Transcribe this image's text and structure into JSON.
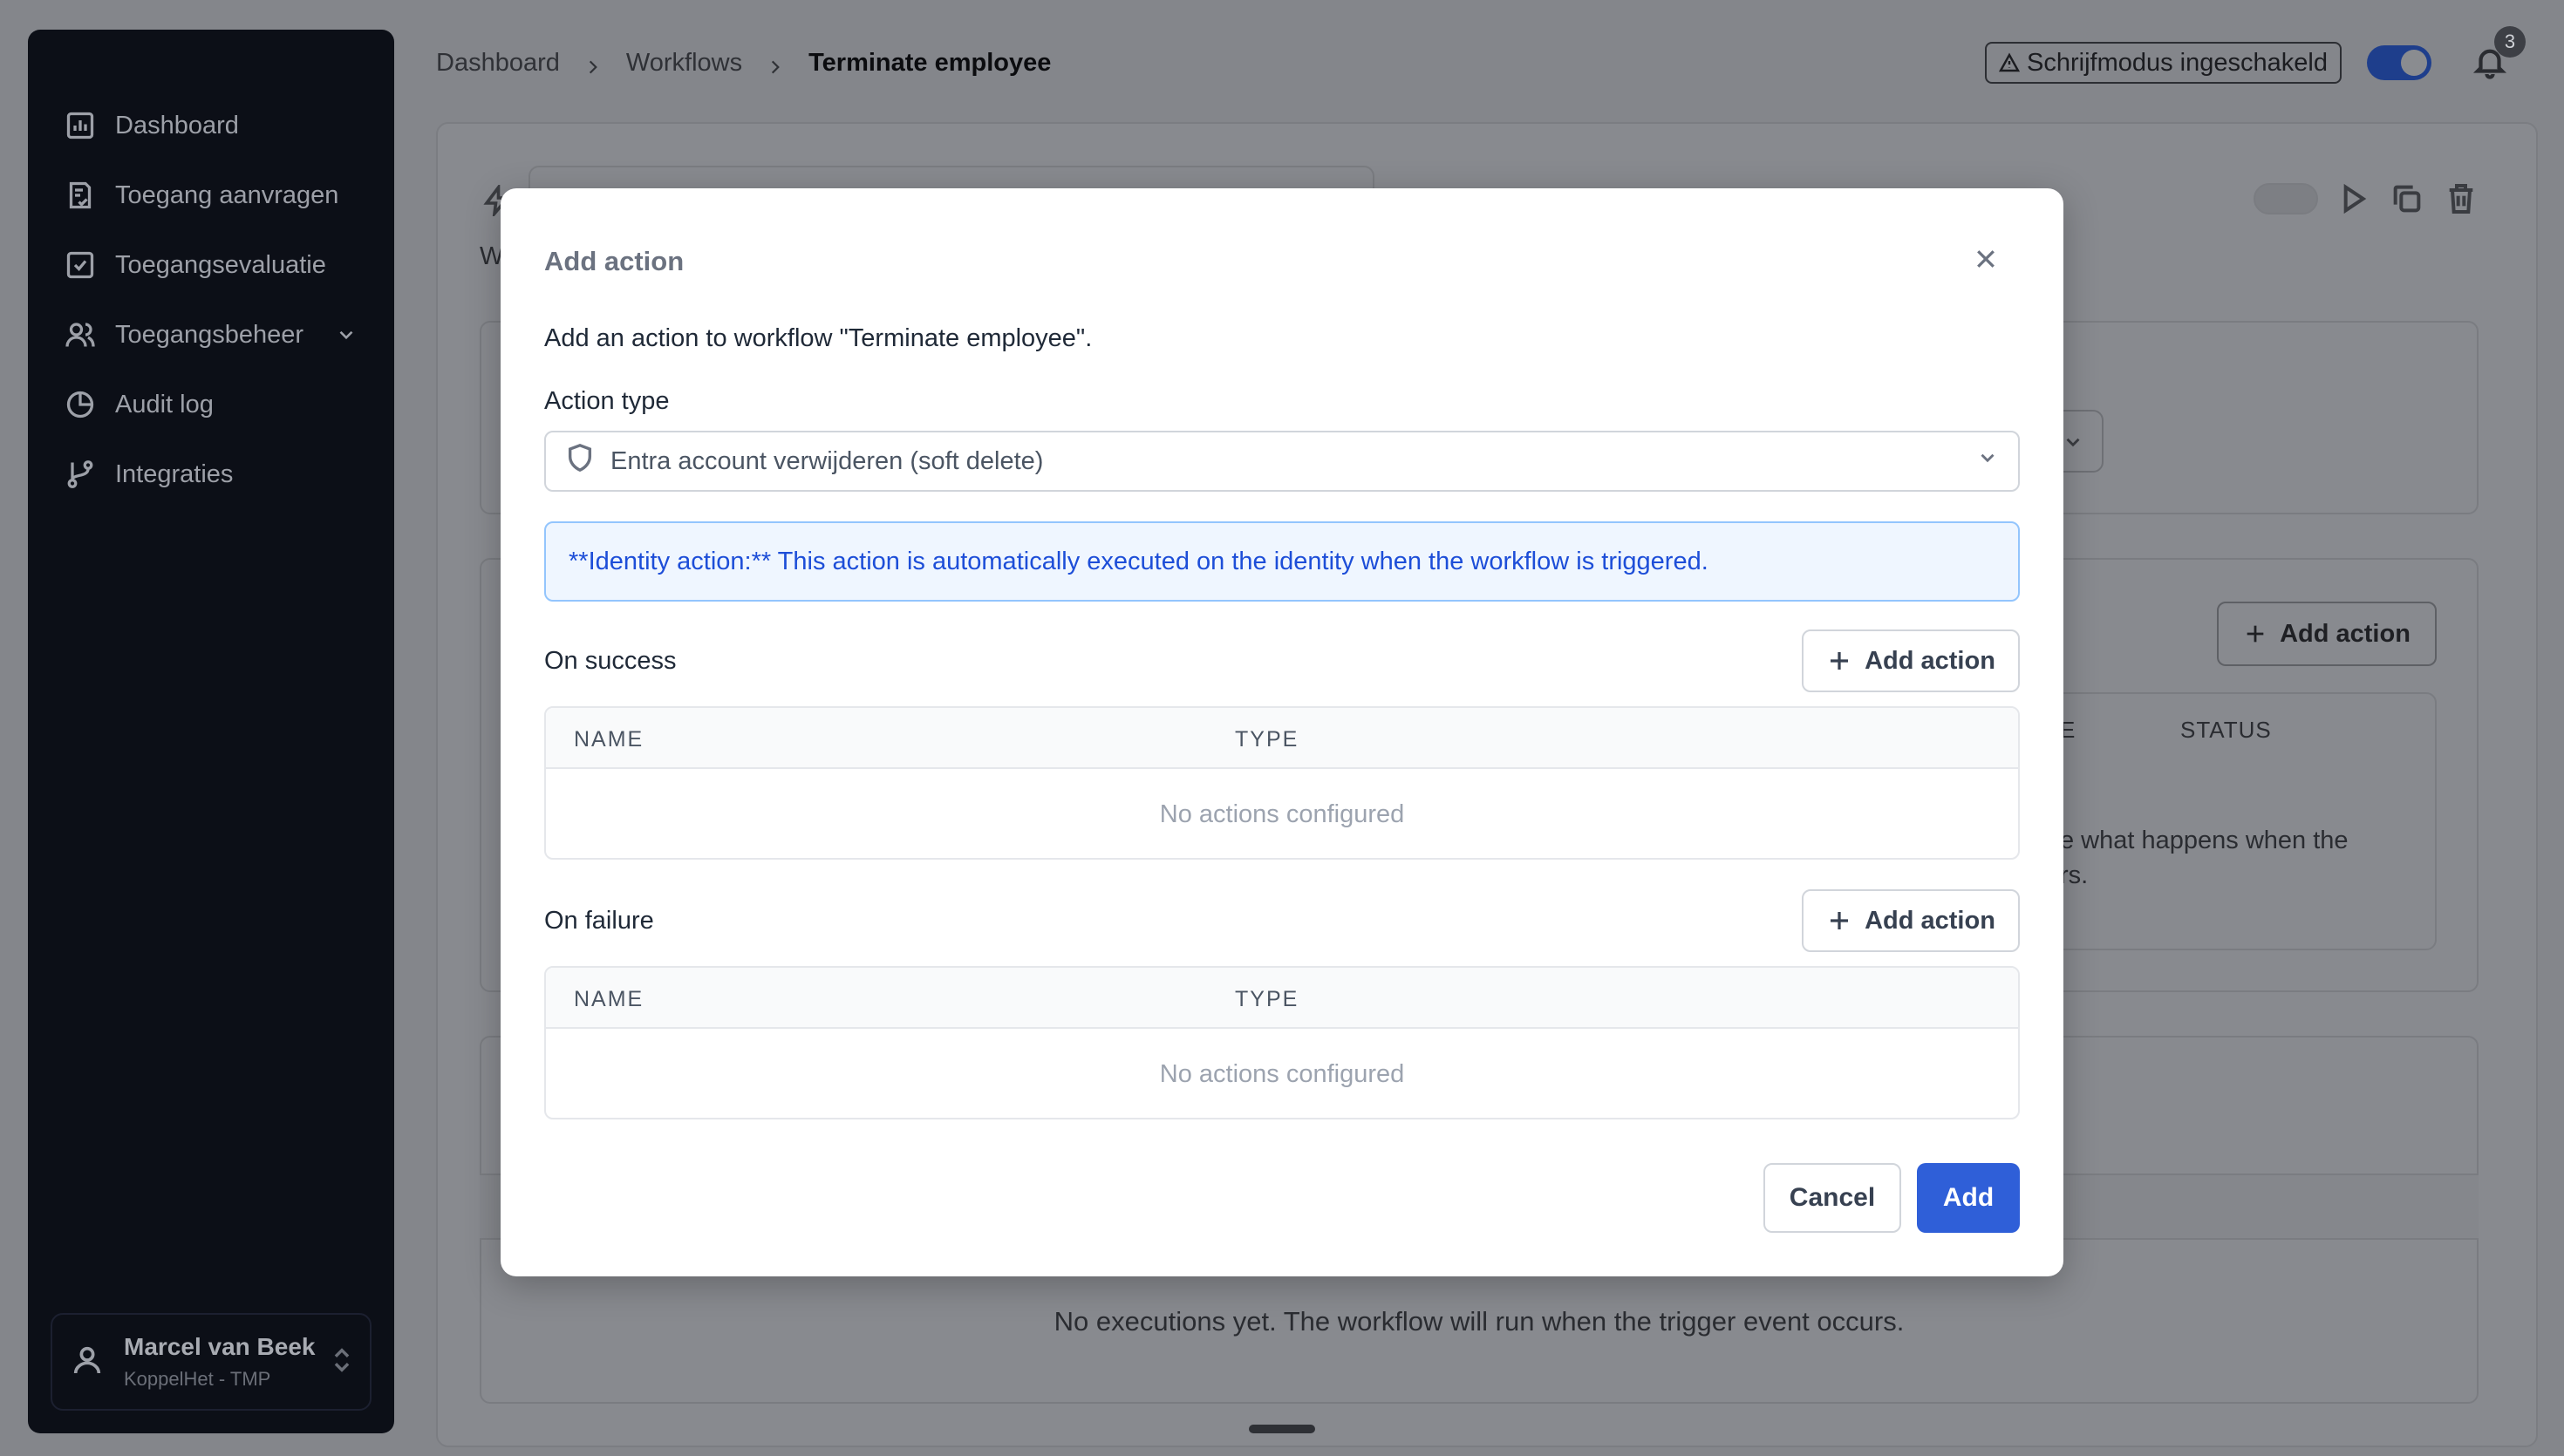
{
  "sidebar": {
    "items": [
      {
        "label": "Dashboard",
        "icon": "bar-chart-icon"
      },
      {
        "label": "Toegang aanvragen",
        "icon": "clipboard-check-icon"
      },
      {
        "label": "Toegangsevaluatie",
        "icon": "square-check-icon"
      },
      {
        "label": "Toegangsbeheer",
        "icon": "users-icon"
      },
      {
        "label": "Audit log",
        "icon": "pie-chart-icon"
      },
      {
        "label": "Integraties",
        "icon": "git-branch-icon"
      }
    ],
    "user": {
      "name": "Marcel van Beek",
      "org": "KoppelHet - TMP"
    }
  },
  "header": {
    "breadcrumb": [
      "Dashboard",
      "Workflows",
      "Terminate employee"
    ],
    "write_mode_badge": "Schrijfmodus ingeschakeld",
    "write_mode_enabled": true,
    "notification_count": "3"
  },
  "background": {
    "description_fragment": "W",
    "add_action_label": "Add action",
    "status_header": "STATUS",
    "type_header_fragment": "E",
    "empty_hint_line1": "e what happens when the",
    "empty_hint_line2": "rs.",
    "no_executions": "No executions yet. The workflow will run when the trigger event occurs."
  },
  "modal": {
    "title": "Add action",
    "description": "Add an action to workflow \"Terminate employee\".",
    "action_type_label": "Action type",
    "action_type_value": "Entra account verwijderen (soft delete)",
    "info": "**Identity action:** This action is automatically executed on the identity when the workflow is triggered.",
    "on_success": {
      "label": "On success",
      "add_label": "Add action",
      "columns": [
        "NAME",
        "TYPE"
      ],
      "empty": "No actions configured"
    },
    "on_failure": {
      "label": "On failure",
      "add_label": "Add action",
      "columns": [
        "NAME",
        "TYPE"
      ],
      "empty": "No actions configured"
    },
    "cancel_label": "Cancel",
    "submit_label": "Add"
  },
  "colors": {
    "primary": "#2f5fd8",
    "info_text": "#1d4ed8",
    "info_bg": "#eff6ff",
    "sidebar_bg": "#0c0f17",
    "overlay": "#84868b"
  }
}
